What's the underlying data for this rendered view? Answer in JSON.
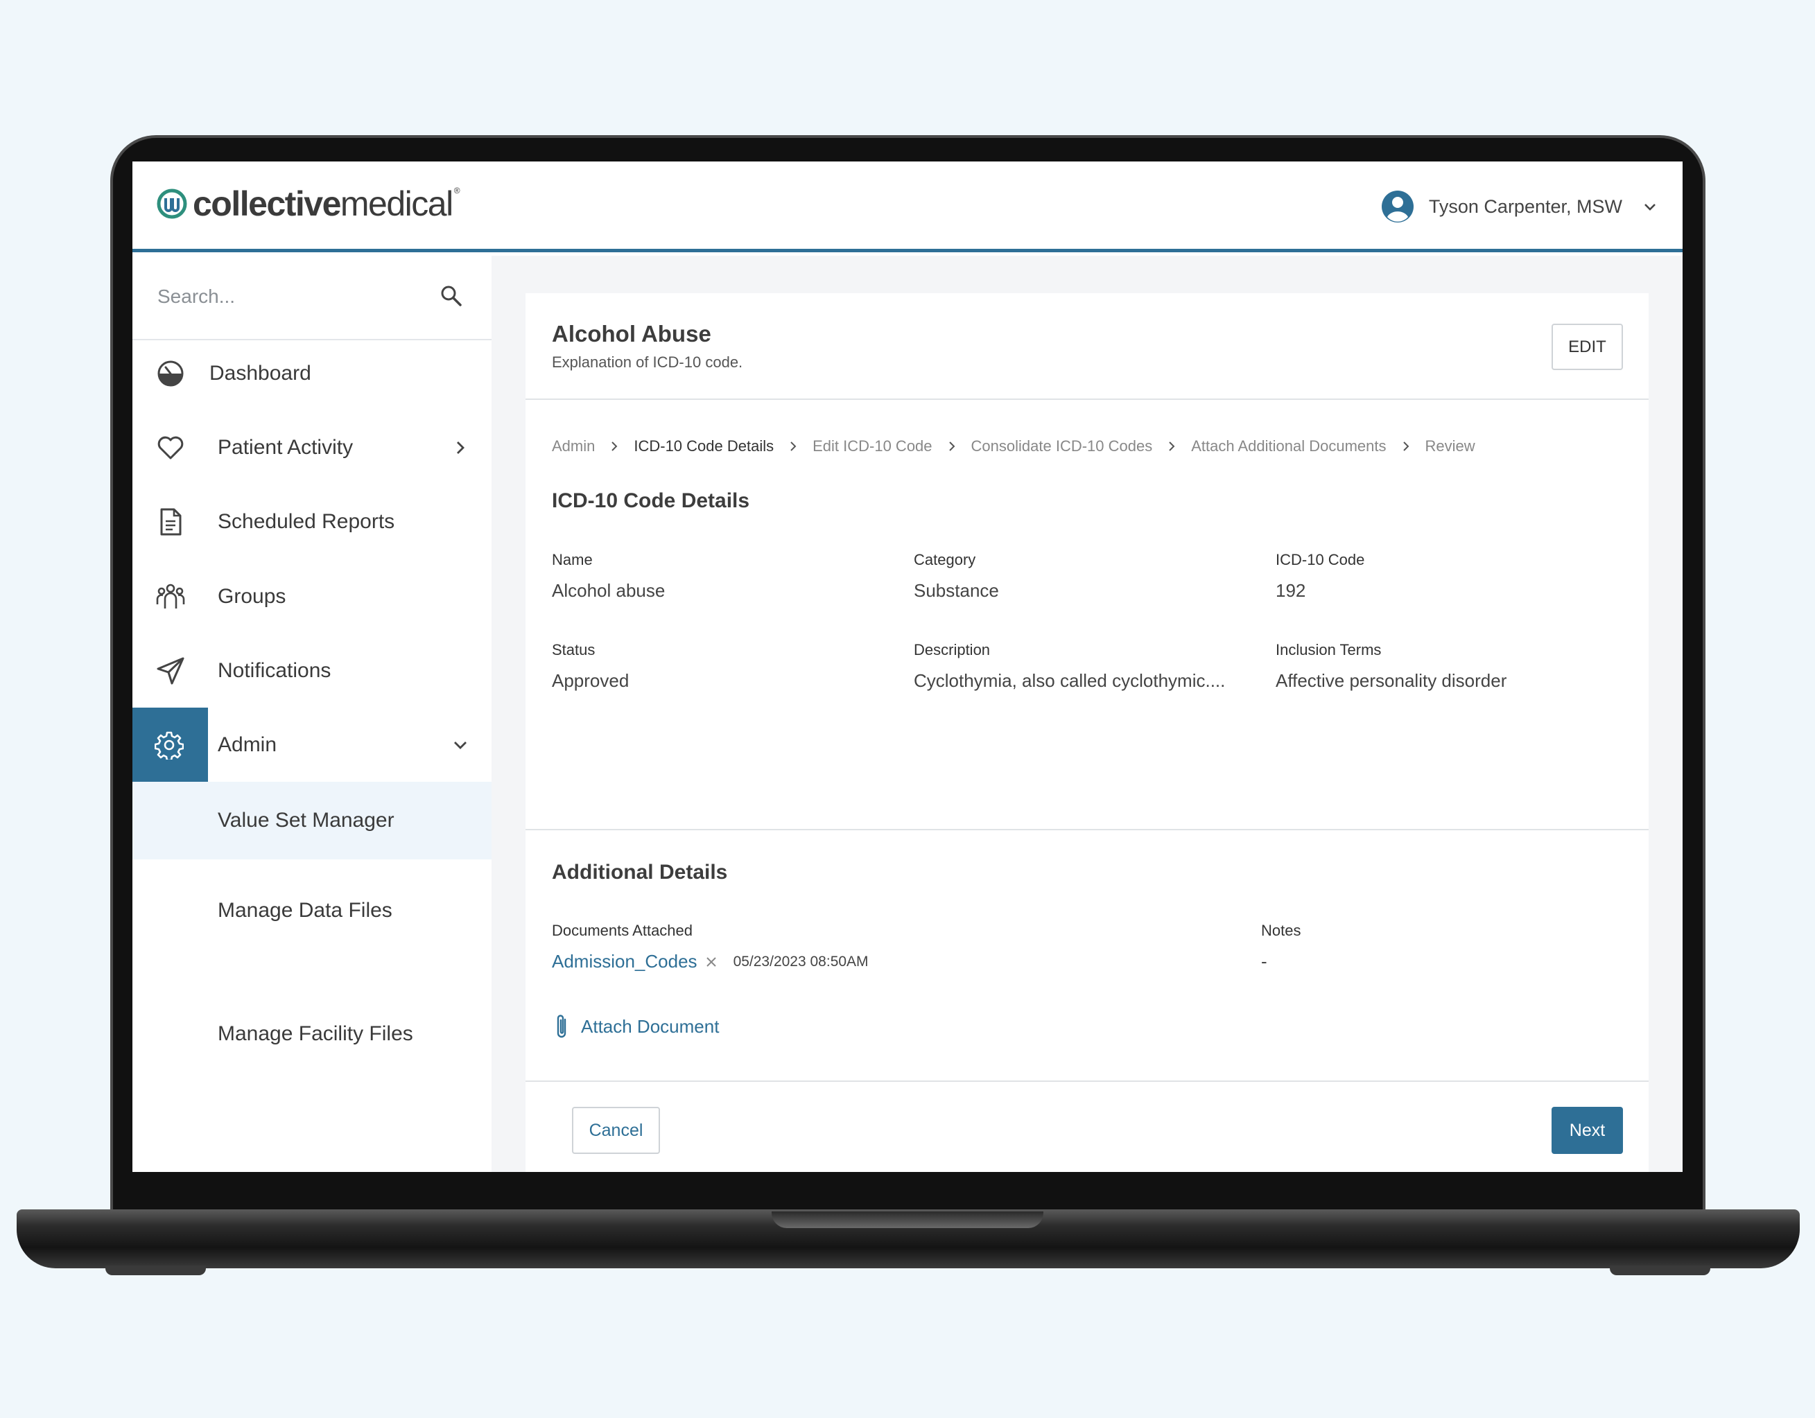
{
  "brand": {
    "name_bold": "collective",
    "name_regular": "medical",
    "registered": "®",
    "accent": "#2e6f96"
  },
  "user": {
    "name": "Tyson Carpenter, MSW",
    "avatar_icon": "user-circle-icon"
  },
  "search": {
    "placeholder": "Search..."
  },
  "sidebar": {
    "items": [
      {
        "label": "Dashboard",
        "icon": "gauge-icon"
      },
      {
        "label": "Patient Activity",
        "icon": "heart-icon"
      },
      {
        "label": "Scheduled Reports",
        "icon": "document-icon"
      },
      {
        "label": "Groups",
        "icon": "group-icon"
      },
      {
        "label": "Notifications",
        "icon": "paper-plane-icon"
      },
      {
        "label": "Admin",
        "icon": "gear-icon",
        "expanded": true
      }
    ],
    "admin_subitems": [
      {
        "label": "Value Set Manager",
        "selected": true
      },
      {
        "label": "Manage Data Files"
      },
      {
        "label": "Manage Facility Files"
      }
    ]
  },
  "page": {
    "title": "Alcohol Abuse",
    "subtitle": "Explanation of ICD-10 code.",
    "edit_label": "EDIT"
  },
  "breadcrumb": [
    "Admin",
    "ICD-10 Code Details",
    "Edit ICD-10 Code",
    "Consolidate ICD-10 Codes",
    "Attach Additional Documents",
    "Review"
  ],
  "details": {
    "section_title": "ICD-10 Code Details",
    "fields": [
      {
        "label": "Name",
        "value": "Alcohol abuse"
      },
      {
        "label": "Category",
        "value": "Substance"
      },
      {
        "label": "ICD-10 Code",
        "value": "192"
      },
      {
        "label": "Status",
        "value": "Approved"
      },
      {
        "label": "Description",
        "value": "Cyclothymia, also called cyclothymic...."
      },
      {
        "label": "Inclusion Terms",
        "value": "Affective personality disorder"
      }
    ]
  },
  "additional": {
    "section_title": "Additional Details",
    "documents_label": "Documents Attached",
    "document_name": "Admission_Codes",
    "document_date": "05/23/2023 08:50AM",
    "notes_label": "Notes",
    "notes_value": "-",
    "attach_label": "Attach Document"
  },
  "footer": {
    "cancel_label": "Cancel",
    "next_label": "Next"
  }
}
